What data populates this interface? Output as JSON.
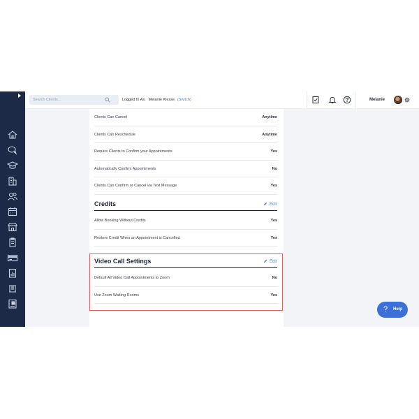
{
  "topbar": {
    "search_placeholder": "Search Clients...",
    "logged_in_label": "Logged In As:",
    "logged_in_user": "Melanie Klesse",
    "switch_label": "(Switch)",
    "user_name": "Melanie"
  },
  "sidebar": {
    "icons": [
      "home-icon",
      "chat-icon",
      "graduation-cap-icon",
      "building-icon",
      "users-icon",
      "calendar-icon",
      "store-icon",
      "clipboard-icon",
      "payment-card-icon",
      "reports-icon",
      "archive-icon",
      "document-icon"
    ]
  },
  "settings": {
    "top_rows": [
      {
        "label": "Clients Can Cancel",
        "value": "Anytime"
      },
      {
        "label": "Clients Can Reschedule",
        "value": "Anytime"
      },
      {
        "label": "Require Clients to Confirm your Appointments",
        "value": "Yes"
      },
      {
        "label": "Automatically Confirm Appointments",
        "value": "No"
      },
      {
        "label": "Clients Can Confirm or Cancel via Text Message",
        "value": "Yes"
      }
    ],
    "credits": {
      "title": "Credits",
      "edit_label": "Edit",
      "rows": [
        {
          "label": "Allow Booking Without Credits",
          "value": "Yes"
        },
        {
          "label": "Restore Credit When an Appointment is Cancelled",
          "value": "Yes"
        }
      ]
    },
    "video": {
      "title": "Video Call Settings",
      "edit_label": "Edit",
      "rows": [
        {
          "label": "Default All Video Call Appointments to Zoom",
          "value": "No"
        },
        {
          "label": "Use Zoom Waiting Rooms",
          "value": "Yes"
        }
      ]
    }
  },
  "help": {
    "icon": "?",
    "label": "Help"
  },
  "colors": {
    "sidebar": "#1c2a47",
    "accent": "#3f8ee8",
    "highlight": "#e0605c",
    "help_button": "#3c6fd8"
  }
}
